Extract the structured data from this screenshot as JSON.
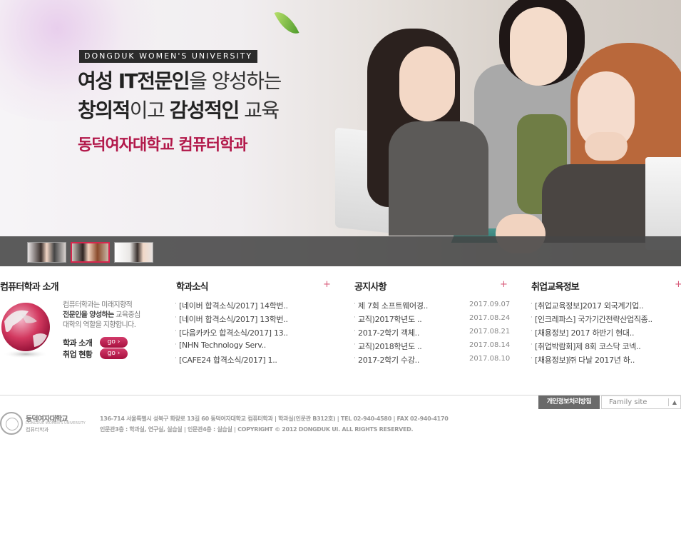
{
  "hero": {
    "tag": "DONGDUK WOMEN'S UNIVERSITY",
    "headline_1a": "여성 IT전문인",
    "headline_1b": "을 양성하는",
    "headline_2a": "창의적",
    "headline_2b": "이고 ",
    "headline_2c": "감성적인",
    "headline_2d": " 교육",
    "dept": "동덕여자대학교 컴퓨터학과",
    "thumbnails": [
      {
        "active": false
      },
      {
        "active": true
      },
      {
        "active": false
      }
    ]
  },
  "intro": {
    "title": "컴퓨터학과 소개",
    "desc_1": "컴퓨터학과는 미래지향적",
    "desc_2a": "전문인을 양성하는",
    "desc_2b": " 교육중심",
    "desc_3": "대학의 역할을 지향합니다.",
    "links": [
      {
        "label": "학과 소개",
        "button": "go ›"
      },
      {
        "label": "취업 현황",
        "button": "go ›"
      }
    ]
  },
  "news": {
    "title": "학과소식",
    "more": "+",
    "items": [
      "[네이버 합격소식/2017] 14학번..",
      "[네이버 합격소식/2017] 13학번..",
      "[다음카카오 합격소식/2017] 13..",
      "[NHN Technology Serv..",
      "[CAFE24 합격소식/2017] 1.."
    ]
  },
  "notice": {
    "title": "공지사항",
    "more": "+",
    "items": [
      {
        "text": "제 7회 소프트웨어경..",
        "date": "2017.09.07"
      },
      {
        "text": "교직)2017학년도 ..",
        "date": "2017.08.24"
      },
      {
        "text": "2017-2학기 객체..",
        "date": "2017.08.21"
      },
      {
        "text": "교직)2018학년도 ..",
        "date": "2017.08.14"
      },
      {
        "text": "2017-2학기 수강..",
        "date": "2017.08.10"
      }
    ]
  },
  "jobs": {
    "title": "취업교육정보",
    "more": "+",
    "items": [
      "[취업교육정보]2017 외국계기업..",
      "[인크레파스] 국가기간전략산업직종..",
      "[채용정보] 2017 하반기 현대..",
      "[취업박람회]제 8회 코스닥 코넥..",
      "[채용정보]㈜ 다날 2017년 하.."
    ]
  },
  "footer": {
    "privacy": "개인정보처리방침",
    "family_site": "Family site",
    "logo_name": "동덕여자대학교",
    "logo_eng": "DONGDUK WOMEN'S UNIVERSITY",
    "logo_dept": "컴퓨터학과",
    "address_1": "136-714 서울특별시 성북구 화랑로 13길 60 동덕여자대학교 컴퓨터학과  |  학과실(인문관 B312호)  |  TEL 02-940-4580  |  FAX 02-940-4170",
    "address_2": "인문관3층 : 학과실, 연구실, 실습실  |  인문관4층 : 실습실  |  COPYRIGHT © 2012 DONGDUK UI. ALL RIGHTS RESERVED."
  },
  "colors": {
    "accent": "#b2184a",
    "thumb_bar": "#464646",
    "plus": "#d85a7a"
  }
}
